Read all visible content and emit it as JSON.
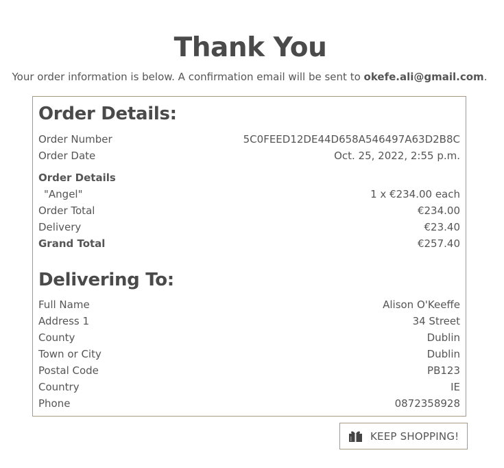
{
  "page": {
    "title": "Thank You",
    "intro_text": "Your order information is below. A confirmation email will be sent to ",
    "email": "okefe.ali@gmail.com",
    "intro_end": "."
  },
  "order": {
    "heading": "Order Details:",
    "number_label": "Order Number",
    "number_value": "5C0FEED12DE44D658A546497A63D2B8C",
    "date_label": "Order Date",
    "date_value": "Oct. 25, 2022, 2:55 p.m.",
    "details_label": "Order Details",
    "item_name": "\"Angel\"",
    "item_value": "1 x €234.00 each",
    "total_label": "Order Total",
    "total_value": "€234.00",
    "delivery_label": "Delivery",
    "delivery_value": "€23.40",
    "grand_label": "Grand Total",
    "grand_value": "€257.40"
  },
  "delivery": {
    "heading": "Delivering To:",
    "rows": [
      {
        "label": "Full Name",
        "value": "Alison O'Keeffe"
      },
      {
        "label": "Address 1",
        "value": "34 Street"
      },
      {
        "label": "County",
        "value": "Dublin"
      },
      {
        "label": "Town or City",
        "value": "Dublin"
      },
      {
        "label": "Postal Code",
        "value": "PB123"
      },
      {
        "label": "Country",
        "value": "IE"
      },
      {
        "label": "Phone",
        "value": "0872358928"
      }
    ]
  },
  "button": {
    "label": "KEEP SHOPPING!",
    "icon": "gifts-icon"
  },
  "colors": {
    "border": "#a89a80",
    "heading": "#4a4a4a",
    "text": "#555555"
  }
}
